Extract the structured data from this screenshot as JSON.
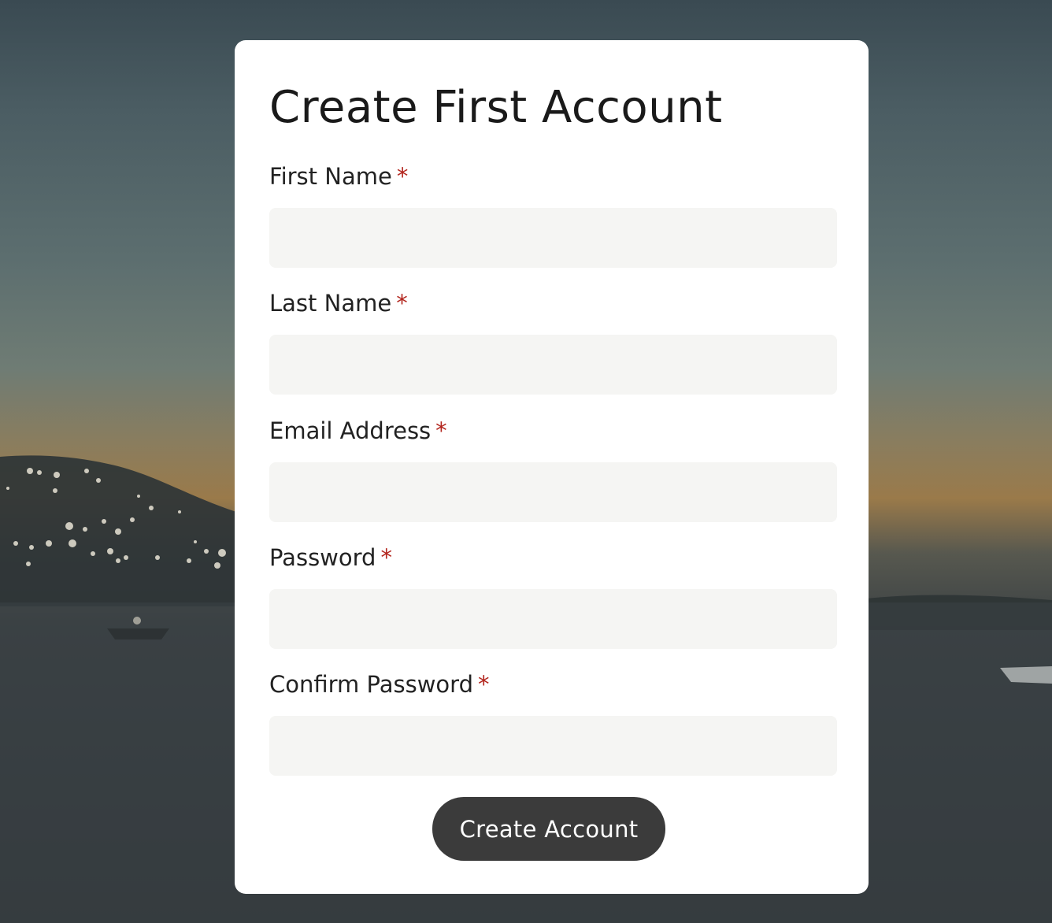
{
  "form": {
    "title": "Create First Account",
    "required_marker": "*",
    "fields": [
      {
        "label": "First Name",
        "value": "",
        "placeholder": ""
      },
      {
        "label": "Last Name",
        "value": "",
        "placeholder": ""
      },
      {
        "label": "Email Address",
        "value": "",
        "placeholder": ""
      },
      {
        "label": "Password",
        "value": "",
        "placeholder": ""
      },
      {
        "label": "Confirm Password",
        "value": "",
        "placeholder": ""
      }
    ],
    "submit_label": "Create Account"
  },
  "colors": {
    "button_bg": "#3b3b3b",
    "required_marker": "#b3261e",
    "input_bg": "#f5f5f3",
    "card_bg": "#ffffff"
  }
}
